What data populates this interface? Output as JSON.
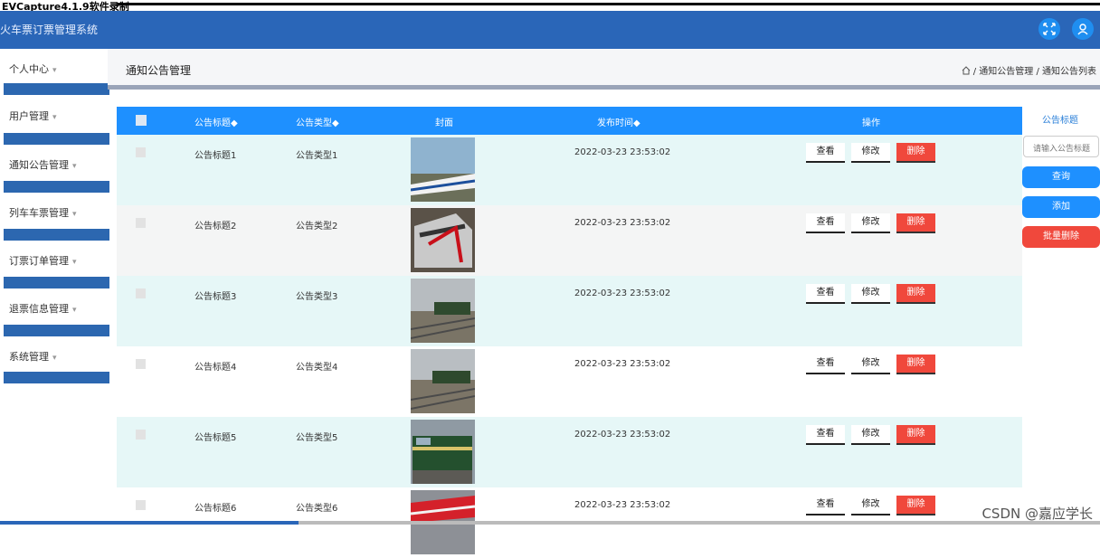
{
  "recorder_caption": "EVCapture4.1.9软件录制",
  "app": {
    "title": "火车票订票管理系统"
  },
  "header": {
    "fullscreen_icon": "expand-icon",
    "user_icon": "user-icon"
  },
  "sidebar": {
    "items": [
      {
        "label": "个人中心"
      },
      {
        "label": "用户管理"
      },
      {
        "label": "通知公告管理"
      },
      {
        "label": "列车车票管理"
      },
      {
        "label": "订票订单管理"
      },
      {
        "label": "退票信息管理"
      },
      {
        "label": "系统管理"
      }
    ],
    "caret": "▾"
  },
  "page": {
    "title": "通知公告管理",
    "breadcrumb": "/ 通知公告管理 / 通知公告列表"
  },
  "table": {
    "columns": {
      "title": "公告标题◆",
      "type": "公告类型◆",
      "cover": "封面",
      "time": "发布时间◆",
      "ops": "操作"
    },
    "rows": [
      {
        "title": "公告标题1",
        "type": "公告类型1",
        "time": "2022-03-23 23:53:02",
        "view": "查看",
        "edit": "修改",
        "del": "删除"
      },
      {
        "title": "公告标题2",
        "type": "公告类型2",
        "time": "2022-03-23 23:53:02",
        "view": "查看",
        "edit": "修改",
        "del": "删除"
      },
      {
        "title": "公告标题3",
        "type": "公告类型3",
        "time": "2022-03-23 23:53:02",
        "view": "查看",
        "edit": "修改",
        "del": "删除"
      },
      {
        "title": "公告标题4",
        "type": "公告类型4",
        "time": "2022-03-23 23:53:02",
        "view": "查看",
        "edit": "修改",
        "del": "删除"
      },
      {
        "title": "公告标题5",
        "type": "公告类型5",
        "time": "2022-03-23 23:53:02",
        "view": "查看",
        "edit": "修改",
        "del": "删除"
      },
      {
        "title": "公告标题6",
        "type": "公告类型6",
        "time": "2022-03-23 23:53:02",
        "view": "查看",
        "edit": "修改",
        "del": "删除"
      }
    ]
  },
  "search": {
    "label": "公告标题",
    "placeholder": "请输入公告标题",
    "query_label": "查询",
    "add_label": "添加",
    "batch_delete_label": "批量删除"
  },
  "colors": {
    "header": "#2a66b8",
    "primary": "#1e90ff",
    "danger": "#f0483c",
    "row_alt": "#e6f7f7"
  },
  "watermark": "CSDN @嘉应学长"
}
